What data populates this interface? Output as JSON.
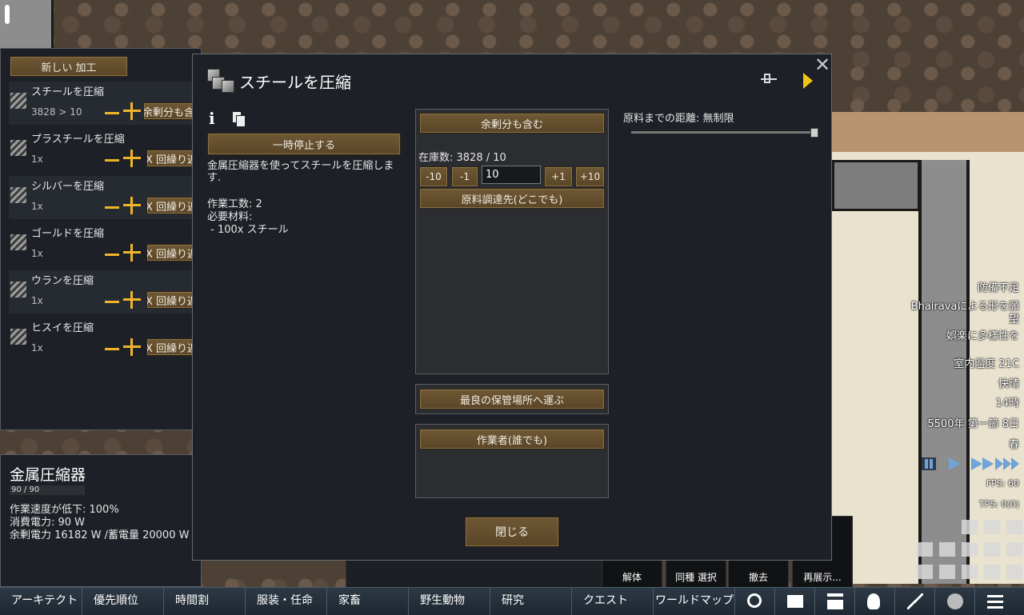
{
  "bills_panel": {
    "new_bill_label": "新しい 加工",
    "bills": [
      {
        "name": "スチールを圧縮",
        "count": "3828 > 10",
        "repeat_label": "余剰分も含む"
      },
      {
        "name": "プラスチールを圧縮",
        "count": "1x",
        "repeat_label": "X 回繰り返す"
      },
      {
        "name": "シルバーを圧縮",
        "count": "1x",
        "repeat_label": "X 回繰り返す"
      },
      {
        "name": "ゴールドを圧縮",
        "count": "1x",
        "repeat_label": "X 回繰り返す"
      },
      {
        "name": "ウランを圧縮",
        "count": "1x",
        "repeat_label": "X 回繰り返す"
      },
      {
        "name": "ヒスイを圧縮",
        "count": "1x",
        "repeat_label": "X 回繰り返す"
      }
    ]
  },
  "inspect": {
    "title": "金属圧縮器",
    "hp": "90 / 90",
    "line1": "作業速度が低下: 100%",
    "line2": "消費電力: 90 W",
    "line3": "余剰電力 16182 W /蓄電量 20000 W"
  },
  "dialog": {
    "title": "スチールを圧縮",
    "close_glyph": "✕",
    "info_glyph": "i",
    "suspend_label": "一時停止する",
    "description": "金属圧縮器を使ってスチールを圧縮します.",
    "work": "作業工数: 2\n必要材料:\n - 100x スチール",
    "repeat_mode_label": "余剰分も含む",
    "stock_label": "在庫数: 3828 / 10",
    "stock_value": "10",
    "steppers": [
      "-10",
      "-1",
      "+1",
      "+10"
    ],
    "ingredient_search_label": "原料調達先(どこでも)",
    "store_mode_label": "最良の保管場所へ運ぶ",
    "worker_label": "作業者(誰でも)",
    "ingredient_radius_label": "原料までの距離: 無制限",
    "ingredient_radius_fraction": 1.0,
    "close_label": "閉じる"
  },
  "hud": {
    "alert1": "防備不足",
    "alert2a": "Bhairavaによる形を願",
    "alert2b": "望",
    "alert3": "娯楽に多様性を",
    "temp": "室内温度 21C",
    "weather": "快晴",
    "hour": "14時",
    "date": "5500年 第一節 8日",
    "season": "春",
    "fps": "FPS: 60",
    "tps": "TPS: 0(0)"
  },
  "designators": [
    "解体",
    "同種 選択",
    "撤去",
    "再展示..."
  ],
  "bottom_tabs": [
    "アーキテクト",
    "優先順位",
    "時間割",
    "服装・任命",
    "家畜",
    "野生動物",
    "研究",
    "クエスト",
    "ワールドマップ"
  ],
  "bottom_icons": [
    "search-icon",
    "book-icon",
    "factions-icon",
    "lightbulb-icon",
    "broom-icon",
    "pawn-icon",
    "menu-icon"
  ]
}
